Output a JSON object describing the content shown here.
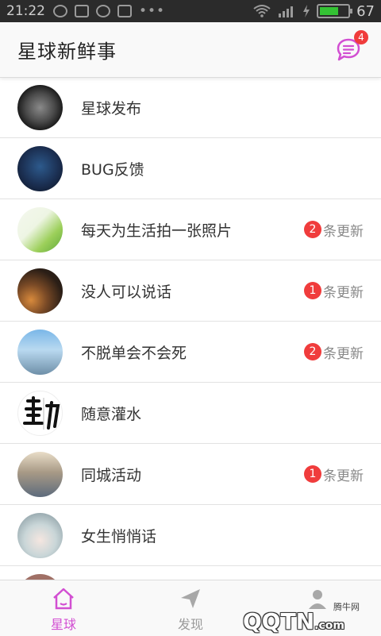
{
  "status_bar": {
    "time": "21:22",
    "battery_level": "67",
    "battery_fraction": 0.67
  },
  "header": {
    "title": "星球新鲜事",
    "message_badge": "4"
  },
  "list": {
    "items": [
      {
        "name": "星球发布",
        "avatar": "moon-avatar",
        "update_count": null,
        "update_label": ""
      },
      {
        "name": "BUG反馈",
        "avatar": "hacker-avatar",
        "update_count": null,
        "update_label": ""
      },
      {
        "name": "每天为生活拍一张照片",
        "avatar": "leaf-avatar",
        "update_count": "2",
        "update_label": "条更新"
      },
      {
        "name": "没人可以说话",
        "avatar": "night-lights-avatar",
        "update_count": "1",
        "update_label": "条更新"
      },
      {
        "name": "不脱单会不会死",
        "avatar": "couple-avatar",
        "update_count": "2",
        "update_label": "条更新"
      },
      {
        "name": "随意灌水",
        "avatar": "calligraphy-avatar",
        "update_count": null,
        "update_label": ""
      },
      {
        "name": "同城活动",
        "avatar": "city-avatar",
        "update_count": "1",
        "update_label": "条更新"
      },
      {
        "name": "女生悄悄话",
        "avatar": "anime-girl-avatar",
        "update_count": null,
        "update_label": ""
      }
    ]
  },
  "tabbar": {
    "tabs": [
      {
        "label": "星球",
        "icon": "home-icon",
        "active": true
      },
      {
        "label": "发现",
        "icon": "send-icon",
        "active": false
      },
      {
        "label": "",
        "icon": "person-icon",
        "active": false
      }
    ]
  },
  "watermark": {
    "brand": "腾牛网",
    "logo": "QQTN",
    "logo_suffix": ".com"
  },
  "colors": {
    "accent": "#d24fd2",
    "badge": "#f03c3c",
    "status_bar_bg": "#2b2b2b",
    "battery_fill": "#34c334"
  }
}
